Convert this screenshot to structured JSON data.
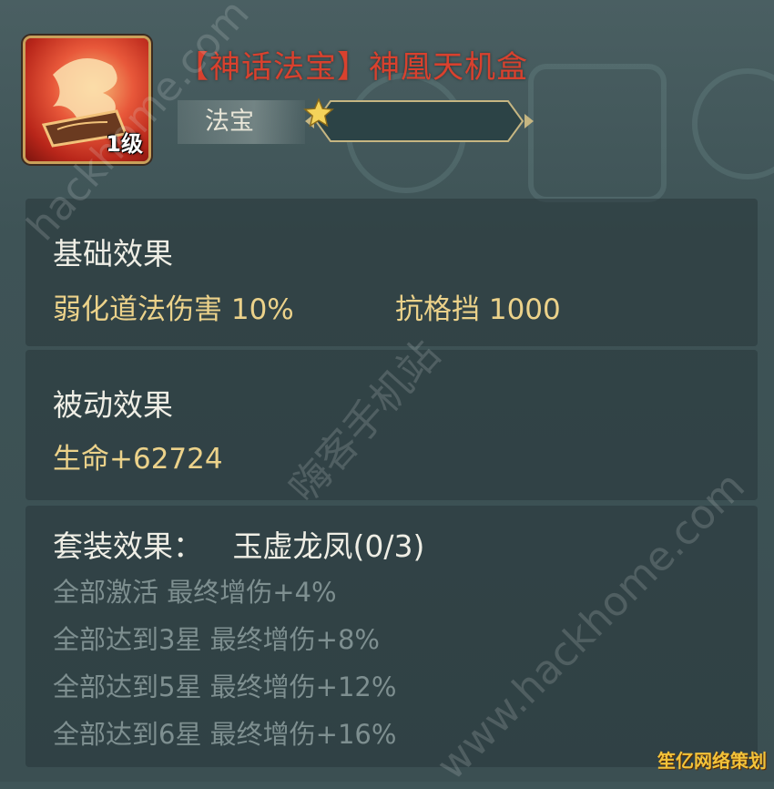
{
  "header": {
    "title": "【神话法宝】神凰天机盒",
    "level": "1级",
    "type_label": "法宝",
    "stars": 1,
    "star_icon": "star-icon",
    "item_icon": "phoenix-box-icon"
  },
  "basic": {
    "title": "基础效果",
    "stats": [
      "弱化道法伤害 10%",
      "抗格挡 1000"
    ]
  },
  "passive": {
    "title": "被动效果",
    "stats": [
      "生命+62724"
    ]
  },
  "set": {
    "title": "套装效果：",
    "name": "玉虚龙凤(0/3)",
    "lines": [
      "全部激活 最终增伤+4%",
      "全部达到3星 最终增伤+8%",
      "全部达到5星 最终增伤+12%",
      "全部达到6星 最终增伤+16%"
    ]
  },
  "watermarks": [
    "hackhome.com",
    "嗨客手机站",
    "www.hackhome.com"
  ],
  "corner_badge": "笙亿网络策划",
  "colors": {
    "title_red": "#d8412e",
    "stat_gold": "#ecd28a",
    "inactive_gray": "#7e8f90"
  }
}
